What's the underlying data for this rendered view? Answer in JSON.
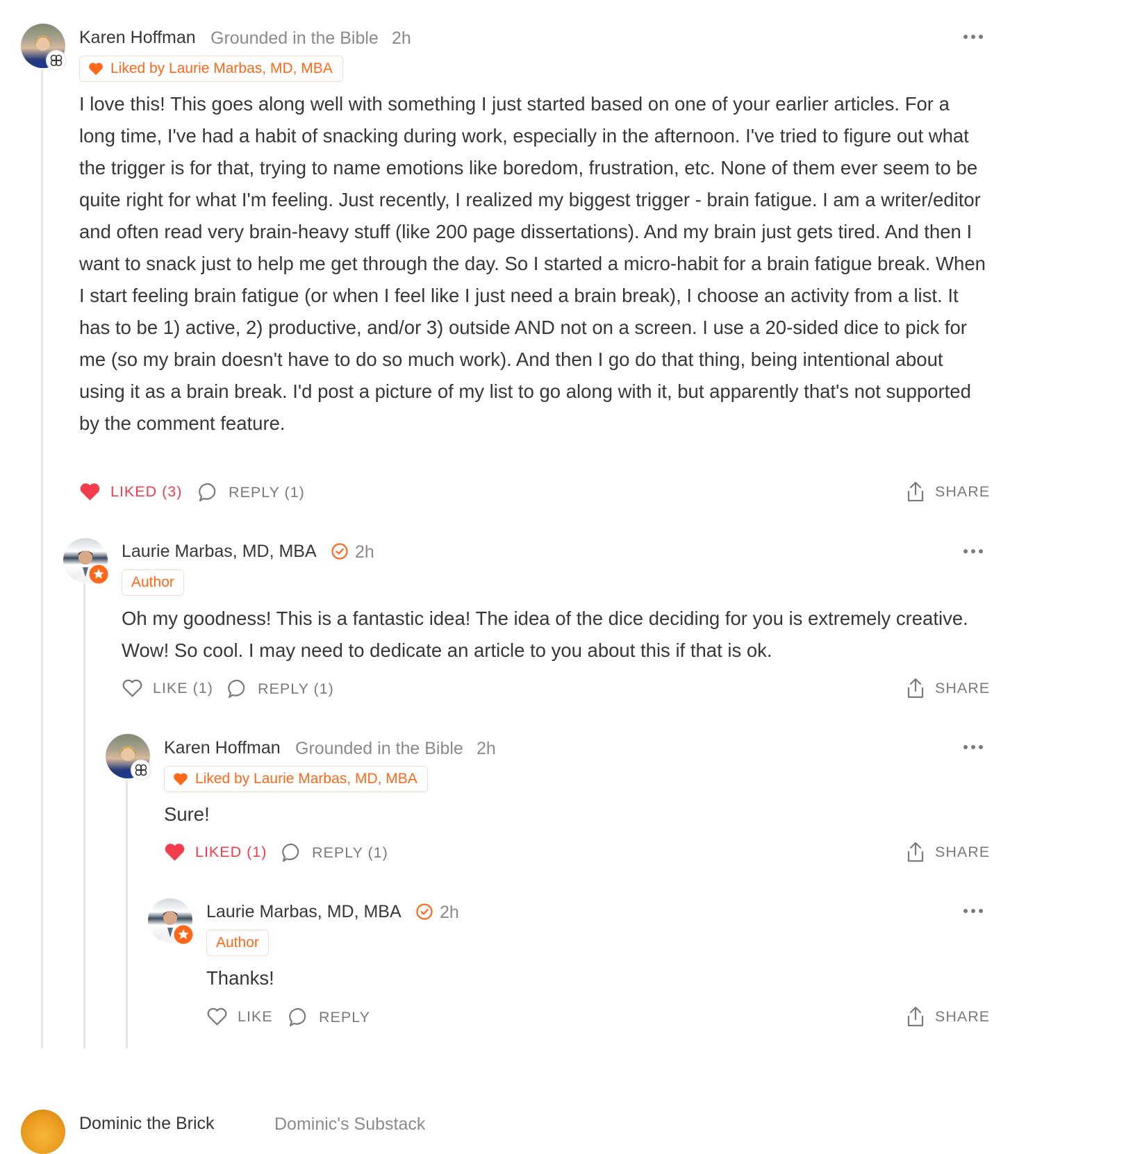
{
  "comments": [
    {
      "author": "Karen Hoffman",
      "publication": "Grounded in the Bible",
      "time": "2h",
      "liked_by": "Liked by Laurie Marbas, MD, MBA",
      "body": "I love this! This goes along well with something I just started based on one of your earlier articles. For a long time, I've had a habit of snacking during work, especially in the afternoon. I've tried to figure out what the trigger is for that, trying to name emotions like boredom, frustration, etc. None of them ever seem to be quite right for what I'm feeling. Just recently, I realized my biggest trigger - brain fatigue. I am a writer/editor and often read very brain-heavy stuff (like 200 page dissertations). And my brain just gets tired. And then I want to snack just to help me get through the day. So I started a micro-habit for a brain fatigue break. When I start feeling brain fatigue (or when I feel like I just need a brain break), I choose an activity from a list. It has to be 1) active, 2) productive, and/or 3) outside AND not on a screen. I use a 20-sided dice to pick for me (so my brain doesn't have to do so much work). And then I go do that thing, being intentional about using it as a brain break. I'd post a picture of my list to go along with it, but apparently that's not supported by the comment feature.",
      "like_label": "LIKED (3)",
      "reply_label": "REPLY (1)",
      "share_label": "SHARE"
    },
    {
      "author": "Laurie Marbas, MD, MBA",
      "time": "2h",
      "role": "Author",
      "body": "Oh my goodness! This is a fantastic idea! The idea of the dice deciding for you is extremely creative. Wow! So cool. I may need to dedicate an article to you about this if that is ok.",
      "like_label": "LIKE (1)",
      "reply_label": "REPLY (1)",
      "share_label": "SHARE"
    },
    {
      "author": "Karen Hoffman",
      "publication": "Grounded in the Bible",
      "time": "2h",
      "liked_by": "Liked by Laurie Marbas, MD, MBA",
      "body": "Sure!",
      "like_label": "LIKED (1)",
      "reply_label": "REPLY (1)",
      "share_label": "SHARE"
    },
    {
      "author": "Laurie Marbas, MD, MBA",
      "time": "2h",
      "role": "Author",
      "body": "Thanks!",
      "like_label": "LIKE",
      "reply_label": "REPLY",
      "share_label": "SHARE"
    }
  ],
  "next_comment_peek": {
    "author": "Dominic the Brick",
    "publication": "Dominic's Substack"
  },
  "colors": {
    "accent": "#ff6719",
    "liked": "#f23d4e",
    "muted": "#7a7a7a",
    "text": "#363737"
  },
  "icons": [
    "heart-icon",
    "comment-bubble-icon",
    "share-icon",
    "more-dots-icon",
    "verified-check-icon",
    "star-badge-icon",
    "subscriber-badge-icon"
  ]
}
